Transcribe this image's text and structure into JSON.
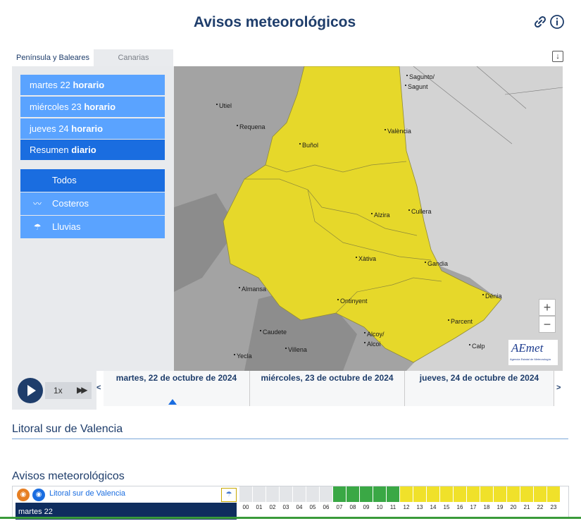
{
  "header": {
    "title": "Avisos meteorológicos",
    "link_icon": "link-icon",
    "info_icon": "info-icon"
  },
  "tabs": [
    {
      "label": "Península y Baleares",
      "active": true
    },
    {
      "label": "Canarias",
      "active": false
    }
  ],
  "download_icon": "download-icon",
  "days": [
    {
      "prefix": "martes 22",
      "suffix": "horario"
    },
    {
      "prefix": "miércoles 23",
      "suffix": "horario"
    },
    {
      "prefix": "jueves 24",
      "suffix": "horario"
    },
    {
      "prefix": "Resumen",
      "suffix": "diario",
      "active": true
    }
  ],
  "filters": [
    {
      "label": "Todos",
      "icon": "",
      "active": true
    },
    {
      "label": "Costeros",
      "icon": "waves-icon"
    },
    {
      "label": "Lluvias",
      "icon": "rain-icon"
    }
  ],
  "map": {
    "cities": [
      {
        "name": "Sagunto/"
      },
      {
        "name": "Sagunt"
      },
      {
        "name": "Utiel"
      },
      {
        "name": "Requena"
      },
      {
        "name": "València"
      },
      {
        "name": "Buñol"
      },
      {
        "name": "Alzira"
      },
      {
        "name": "Cullera"
      },
      {
        "name": "Xàtiva"
      },
      {
        "name": "Gandia"
      },
      {
        "name": "Almansa"
      },
      {
        "name": "Dénia"
      },
      {
        "name": "Ontinyent"
      },
      {
        "name": "Parcent"
      },
      {
        "name": "Caudete"
      },
      {
        "name": "Alcoy/"
      },
      {
        "name": "Alcoi"
      },
      {
        "name": "Villena"
      },
      {
        "name": "Calp"
      },
      {
        "name": "Yecla"
      }
    ],
    "zoom_in": "+",
    "zoom_out": "−",
    "logo_text": "AEmet",
    "logo_subtext": "Agencia Estatal de Meteorología",
    "warning_color": "#e6d82a"
  },
  "timeline": {
    "speed": "1x",
    "prev": "<",
    "next": ">",
    "dates": [
      "martes, 22 de octubre de 2024",
      "miércoles, 23 de octubre de 2024",
      "jueves, 24 de octubre de 2024"
    ],
    "selected_index": 0
  },
  "zone_title": "Litoral sur de Valencia",
  "warnings": {
    "title": "Avisos meteorológicos",
    "zone_link": "Litoral sur de Valencia",
    "day_label": "martes 22",
    "hours": [
      "00",
      "01",
      "02",
      "03",
      "04",
      "05",
      "06",
      "07",
      "08",
      "09",
      "10",
      "11",
      "12",
      "13",
      "14",
      "15",
      "16",
      "17",
      "18",
      "19",
      "20",
      "21",
      "22",
      "23"
    ],
    "hour_levels": [
      "none",
      "none",
      "none",
      "none",
      "none",
      "none",
      "none",
      "green",
      "green",
      "green",
      "green",
      "green",
      "yellow",
      "yellow",
      "yellow",
      "yellow",
      "yellow",
      "yellow",
      "yellow",
      "yellow",
      "yellow",
      "yellow",
      "yellow",
      "yellow"
    ],
    "colors": {
      "none": "#e3e5e8",
      "green": "#3aa845",
      "yellow": "#f0e12a"
    }
  }
}
